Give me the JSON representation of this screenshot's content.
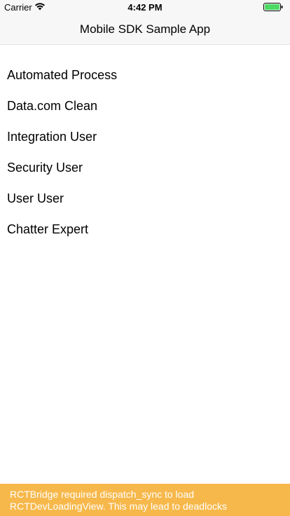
{
  "status_bar": {
    "carrier": "Carrier",
    "time": "4:42 PM",
    "battery_color": "#4cd964"
  },
  "nav": {
    "title": "Mobile SDK Sample App"
  },
  "users": [
    {
      "name": "Automated Process"
    },
    {
      "name": "Data.com Clean"
    },
    {
      "name": "Integration User"
    },
    {
      "name": "Security User"
    },
    {
      "name": "User User"
    },
    {
      "name": "Chatter Expert"
    }
  ],
  "warning": {
    "text": "RCTBridge required dispatch_sync to load RCTDevLoadingView. This may lead to deadlocks",
    "background": "#f7b84b"
  }
}
